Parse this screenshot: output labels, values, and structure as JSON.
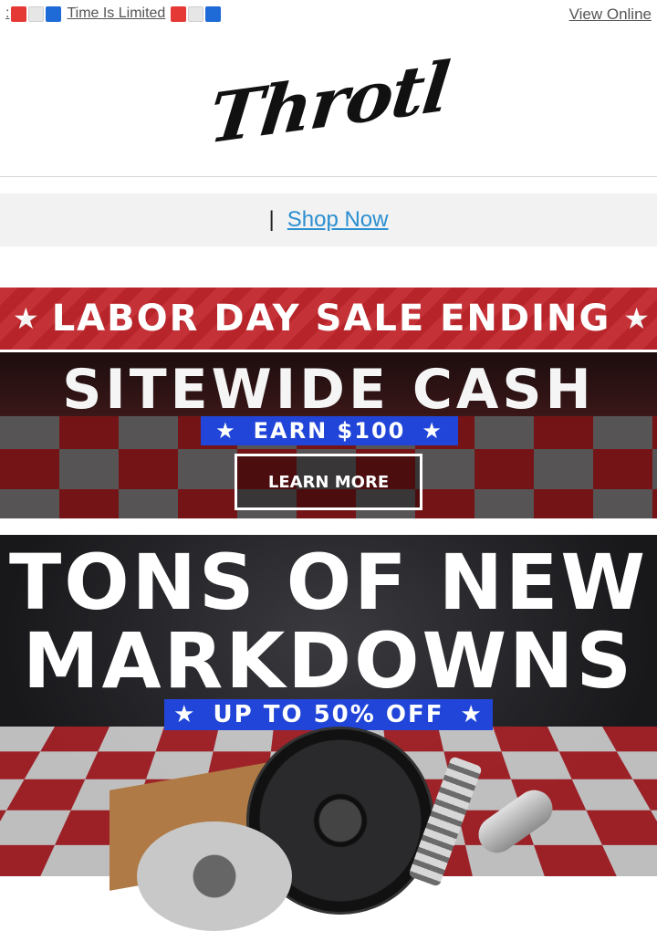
{
  "preheader": {
    "prefix": ":",
    "text": "Time Is Limited",
    "view_online": "View Online",
    "flag_colors": [
      "#e53935",
      "#e6e6e6",
      "#1e6ad6"
    ]
  },
  "logo": {
    "text": "Throtl"
  },
  "nav": {
    "separator": "|",
    "shop_now": "Shop Now"
  },
  "strip": {
    "text": "LABOR DAY SALE ENDING",
    "star": "★"
  },
  "cash_banner": {
    "title": "SITEWIDE CASH",
    "pill": "EARN $100",
    "pill_star": "★",
    "button": "LEARN MORE"
  },
  "markdowns_banner": {
    "line1": "TONS OF NEW",
    "line2": "MARKDOWNS",
    "pill": "UP TO 50% OFF",
    "pill_star": "★"
  },
  "colors": {
    "red": "#c1272d",
    "blue_pill": "#2045d8",
    "link": "#2a8fd0"
  }
}
